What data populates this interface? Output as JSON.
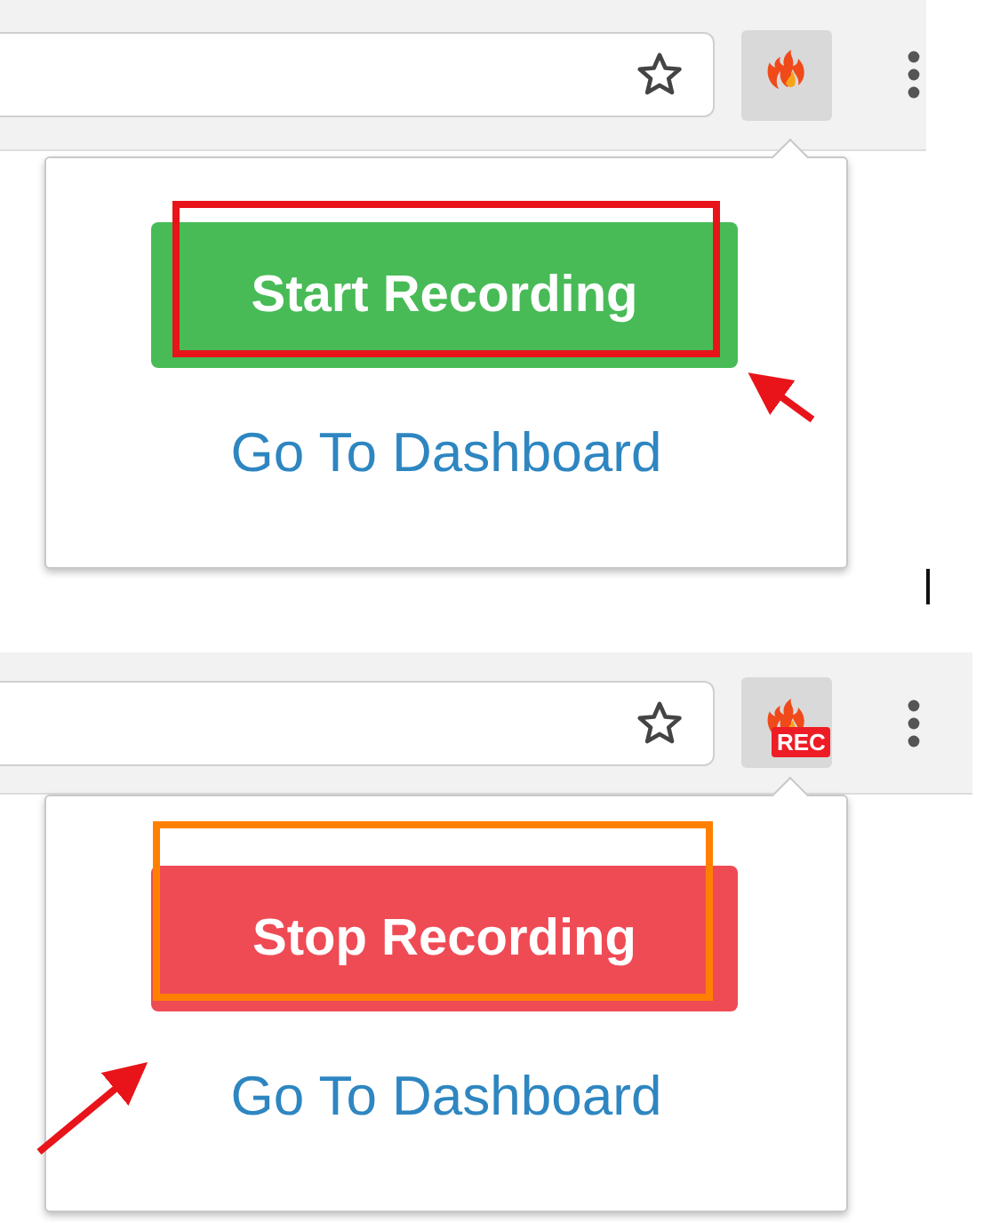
{
  "panels": [
    {
      "kind": "start",
      "button": {
        "label": "Start Recording"
      },
      "link": "Go To Dashboard",
      "highlight": {
        "color": "#e8141a"
      }
    },
    {
      "kind": "stop",
      "badge": "REC",
      "button": {
        "label": "Stop Recording"
      },
      "link": "Go To Dashboard",
      "highlight": {
        "color": "#ff8000"
      }
    }
  ]
}
